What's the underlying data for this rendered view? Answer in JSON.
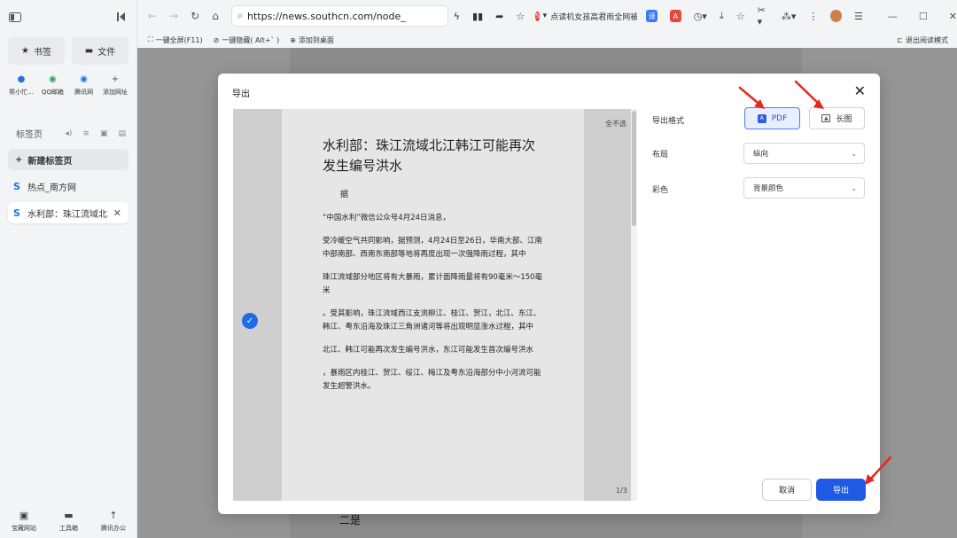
{
  "sidebar": {
    "bookmarks_label": "书签",
    "files_label": "文件",
    "apps": [
      {
        "label": "帮小忙...",
        "icon": "blue-app-icon"
      },
      {
        "label": "QQ邮箱",
        "icon": "qq-mail-icon"
      },
      {
        "label": "腾讯网",
        "icon": "tencent-icon"
      },
      {
        "label": "添加网址",
        "icon": "plus-icon"
      }
    ],
    "tabs_heading": "标签页",
    "new_tab_label": "新建标签页",
    "tabs": [
      {
        "label": "热点_南方网",
        "active": false
      },
      {
        "label": "水利部：珠江流域北江",
        "active": true
      }
    ],
    "bottom": [
      {
        "label": "宝藏网站"
      },
      {
        "label": "工具箱"
      },
      {
        "label": "腾讯办公"
      }
    ]
  },
  "toolbar": {
    "url": "https://news.southcn.com/node_",
    "news_ticker": "点读机女孩高君雨全网被刮",
    "ext_label_1": "",
    "ext_label_2": ""
  },
  "bookmark_bar": {
    "items": [
      "一键全屏(F11)",
      "一键隐藏( Alt+` )",
      "添加到桌面"
    ],
    "exit_reader": "退出阅读模式"
  },
  "page": {
    "bottom_text": "二是"
  },
  "dialog": {
    "title": "导出",
    "deselect_all": "全不选",
    "page_indicator": "1/3",
    "article": {
      "title": "水利部：珠江流域北江韩江可能再次发生编号洪水",
      "author": "据",
      "paragraphs": [
        "“中国水利”微信公众号4月24日消息，",
        "受冷暖空气共同影响，据预测，4月24日至26日，华南大部、江南中部南部、西南东南部等地将再度出现一次强降雨过程，其中",
        "珠江流域部分地区将有大暴雨，累计面降雨量将有90毫米～150毫米",
        "。受其影响，珠江流域西江支流柳江、桂江、贺江，北江、东江、韩江、粤东沿海及珠江三角洲诸河等将出现明显涨水过程，其中",
        "北江、韩江可能再次发生编号洪水，东江可能发生首次编号洪水",
        "，暴雨区内桂江、贺江、绥江、梅江及粤东沿海部分中小河流可能发生超警洪水。"
      ]
    },
    "format_label": "导出格式",
    "format_pdf": "PDF",
    "format_long_image": "长图",
    "layout_label": "布局",
    "layout_value": "纵向",
    "color_label": "彩色",
    "color_value": "背景颜色",
    "cancel_label": "取消",
    "export_label": "导出"
  },
  "colors": {
    "accent": "#1f5ae6",
    "annotation": "#e8261e"
  }
}
